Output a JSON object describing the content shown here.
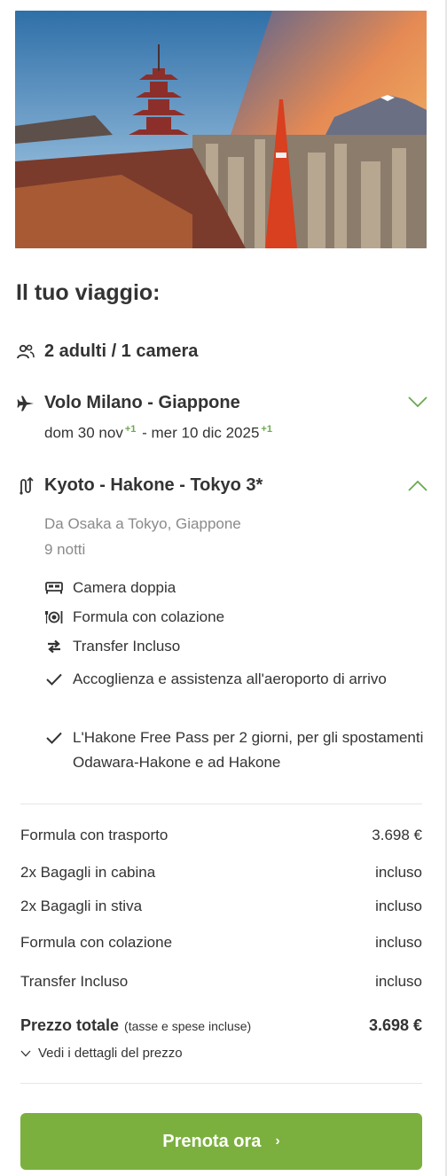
{
  "trip": {
    "title": "Il tuo viaggio:",
    "travellers": "2 adulti / 1 camera"
  },
  "flight": {
    "title": "Volo Milano - Giappone",
    "dep": "dom 30 nov",
    "dep_offset": "+1",
    "separator": " - ",
    "ret": "mer 10 dic 2025",
    "ret_offset": "+1"
  },
  "tour": {
    "title": "Kyoto - Hakone - Tokyo 3*",
    "location": "Da Osaka a Tokyo, Giappone",
    "nights": "9 notti",
    "features": [
      {
        "icon": "bed-icon",
        "text": "Camera doppia"
      },
      {
        "icon": "meal-icon",
        "text": "Formula con colazione"
      },
      {
        "icon": "transfer-icon",
        "text": "Transfer Incluso"
      },
      {
        "icon": "check-icon",
        "text": "Accoglienza e assistenza all'aeroporto di arrivo"
      },
      {
        "icon": "check-icon",
        "text": "L'Hakone Free Pass per 2 giorni, per gli spostamenti Odawara-Hakone e ad Hakone"
      }
    ]
  },
  "price": {
    "rows": [
      {
        "label": "Formula con trasporto",
        "value": "3.698 €"
      },
      {
        "label": "2x Bagagli in cabina",
        "value": "incluso"
      },
      {
        "label": "2x Bagagli in stiva",
        "value": "incluso"
      },
      {
        "label": "Formula con colazione",
        "value": "incluso"
      },
      {
        "label": "Transfer Incluso",
        "value": "incluso"
      }
    ],
    "total_label": "Prezzo totale",
    "total_note": "(tasse e spese incluse)",
    "total_value": "3.698 €",
    "details_link": "Vedi i dettagli del prezzo"
  },
  "cta": {
    "label": "Prenota ora"
  },
  "colors": {
    "accent": "#7bb03f",
    "offset": "#6aa84f",
    "text": "#333333"
  }
}
